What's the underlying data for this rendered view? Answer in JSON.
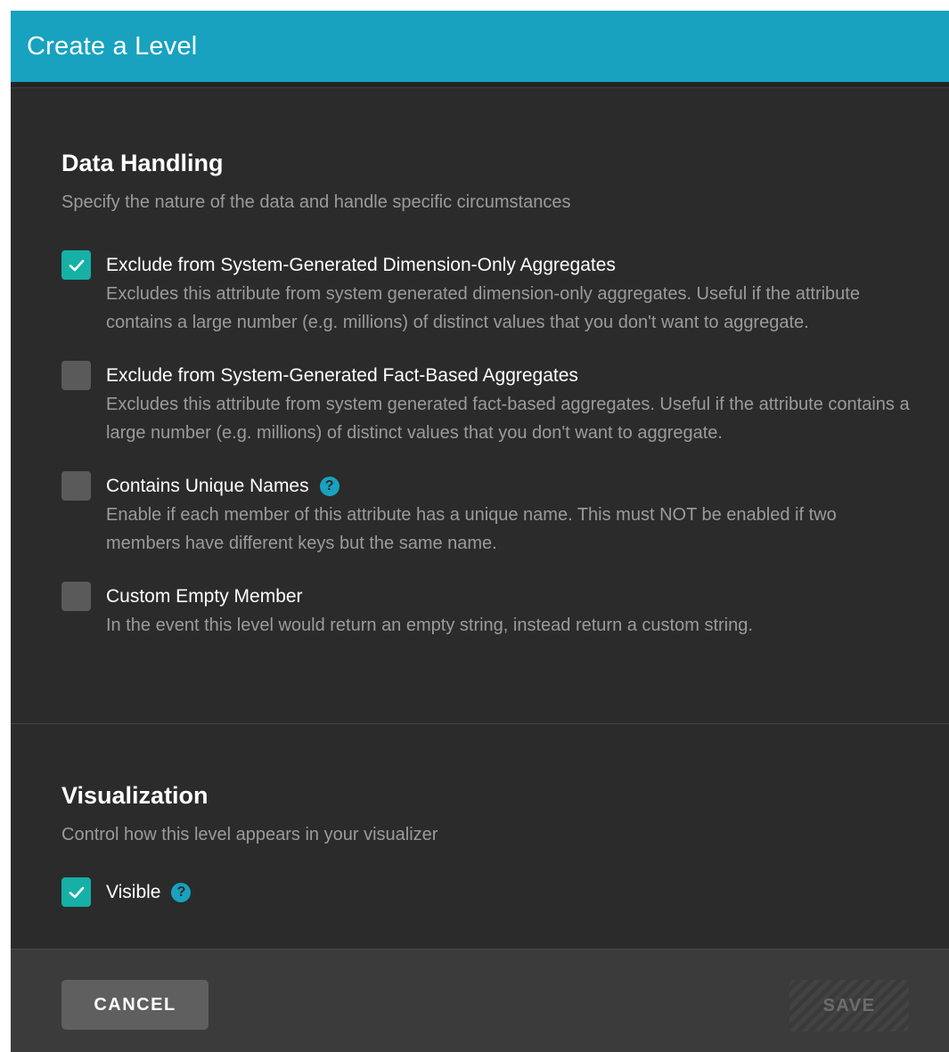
{
  "dialog": {
    "title": "Create a Level"
  },
  "data_handling": {
    "title": "Data Handling",
    "description": "Specify the nature of the data and handle specific circumstances",
    "options": [
      {
        "label": "Exclude from System-Generated Dimension-Only Aggregates",
        "description": "Excludes this attribute from system generated dimension-only aggregates. Useful if the attribute contains a large number (e.g. millions) of distinct values that you don't want to aggregate.",
        "checked": true
      },
      {
        "label": "Exclude from System-Generated Fact-Based Aggregates",
        "description": "Excludes this attribute from system generated fact-based aggregates. Useful if the attribute contains a large number (e.g. millions) of distinct values that you don't want to aggregate.",
        "checked": false
      },
      {
        "label": "Contains Unique Names",
        "description": "Enable if each member of this attribute has a unique name. This must NOT be enabled if two members have different keys but the same name.",
        "checked": false,
        "help_icon": "question-circle-icon"
      },
      {
        "label": "Custom Empty Member",
        "description": "In the event this level would return an empty string, instead return a custom string.",
        "checked": false
      }
    ]
  },
  "visualization": {
    "title": "Visualization",
    "description": "Control how this level appears in your visualizer",
    "visible": {
      "label": "Visible",
      "checked": true,
      "help_icon": "question-circle-icon"
    }
  },
  "footer": {
    "cancel_label": "CANCEL",
    "save_label": "SAVE",
    "save_disabled": true
  },
  "colors": {
    "header": "#18a2bf",
    "panel": "#2b2b2b",
    "checkbox_checked": "#16b0a6",
    "checkbox_unchecked": "#5a5a5a",
    "help_icon": "#18a2bf",
    "muted_text": "#9b9b9b"
  }
}
